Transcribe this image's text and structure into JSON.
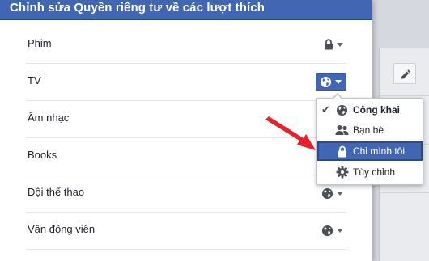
{
  "dialog": {
    "title": "Chỉnh sửa Quyền riêng tư về các lượt thích"
  },
  "rows": [
    {
      "label": "Phim",
      "privacy_icon": "lock-icon"
    },
    {
      "label": "TV",
      "privacy_icon": "globe-icon"
    },
    {
      "label": "Âm nhạc",
      "privacy_icon": ""
    },
    {
      "label": "Books",
      "privacy_icon": ""
    },
    {
      "label": "Đội thể thao",
      "privacy_icon": "globe-icon"
    },
    {
      "label": "Vận động viên",
      "privacy_icon": "globe-icon"
    }
  ],
  "privacy_menu": {
    "items": [
      {
        "label": "Công khai",
        "icon": "globe-icon",
        "checked": true
      },
      {
        "label": "Bạn bè",
        "icon": "friends-icon",
        "checked": false
      },
      {
        "label": "Chỉ mình tôi",
        "icon": "lock-icon",
        "highlighted": true
      },
      {
        "label": "Tùy chỉnh",
        "icon": "gear-icon",
        "checked": false
      }
    ]
  },
  "colors": {
    "header": "#4267b2",
    "highlight": "#4267b2",
    "arrow": "#e8202a"
  }
}
